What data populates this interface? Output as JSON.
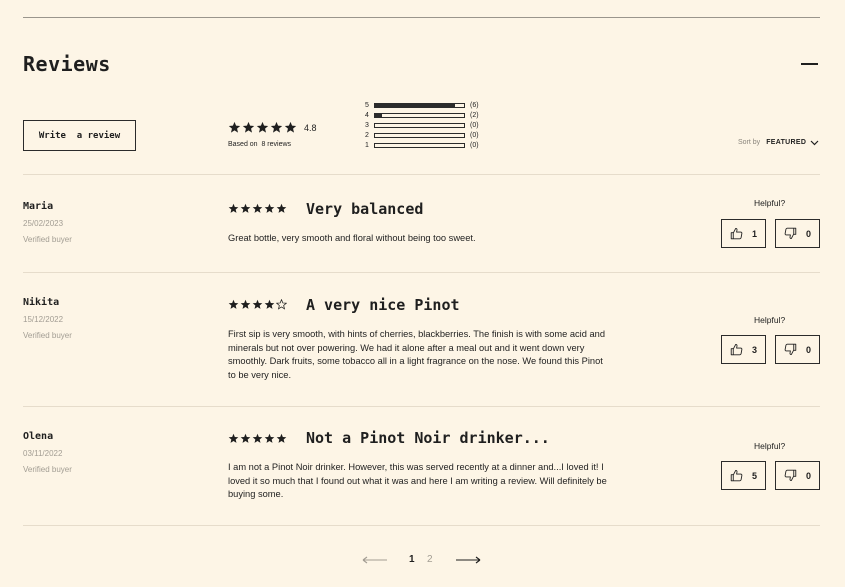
{
  "header": {
    "title": "Reviews"
  },
  "summary": {
    "write_label": "Write  a review",
    "average": "4.8",
    "average_stars": 5,
    "based_on": "Based on  8 reviews",
    "distribution": [
      {
        "level": "5",
        "count": "(6)",
        "fraction": 0.9
      },
      {
        "level": "4",
        "count": "(2)",
        "fraction": 0.08
      },
      {
        "level": "3",
        "count": "(0)",
        "fraction": 0
      },
      {
        "level": "2",
        "count": "(0)",
        "fraction": 0
      },
      {
        "level": "1",
        "count": "(0)",
        "fraction": 0
      }
    ],
    "sort_label": "Sort by",
    "sort_value": "FEATURED"
  },
  "reviews": [
    {
      "name": "Maria",
      "date": "25/02/2023",
      "verified": "Verified buyer",
      "rating": 5,
      "title": "Very balanced",
      "body": "Great bottle, very smooth and floral without being too sweet.",
      "helpful_label": "Helpful?",
      "up": "1",
      "down": "0"
    },
    {
      "name": "Nikita",
      "date": "15/12/2022",
      "verified": "Verified buyer",
      "rating": 4,
      "title": "A very nice Pinot",
      "body": "First sip is very smooth, with hints of cherries, blackberries. The finish is with some acid and minerals but not over powering. We had it alone after a meal out and it went down very smoothly. Dark fruits, some tobacco all in a light fragrance on the nose. We found this Pinot to be very nice.",
      "helpful_label": "Helpful?",
      "up": "3",
      "down": "0"
    },
    {
      "name": "Olena",
      "date": "03/11/2022",
      "verified": "Verified buyer",
      "rating": 5,
      "title": "Not a Pinot Noir drinker...",
      "body": "I am not a Pinot Noir drinker. However, this was served recently at a dinner and...I loved it! I loved it so much that I found out what it was and here I am writing a review. Will definitely be buying some.",
      "helpful_label": "Helpful?",
      "up": "5",
      "down": "0"
    }
  ],
  "pagination": {
    "pages": [
      "1",
      "2"
    ],
    "current": "1"
  },
  "icons": {
    "star": "star-icon",
    "thumb_up": "thumbs-up-icon",
    "thumb_down": "thumbs-down-icon",
    "prev": "arrow-left-icon",
    "next": "arrow-right-icon",
    "chevron": "chevron-down-icon",
    "collapse": "minus-icon"
  },
  "colors": {
    "background": "#fdf5e6",
    "ink": "#1f1f1f",
    "muted": "#a29d93",
    "divider": "#e6dccb"
  }
}
